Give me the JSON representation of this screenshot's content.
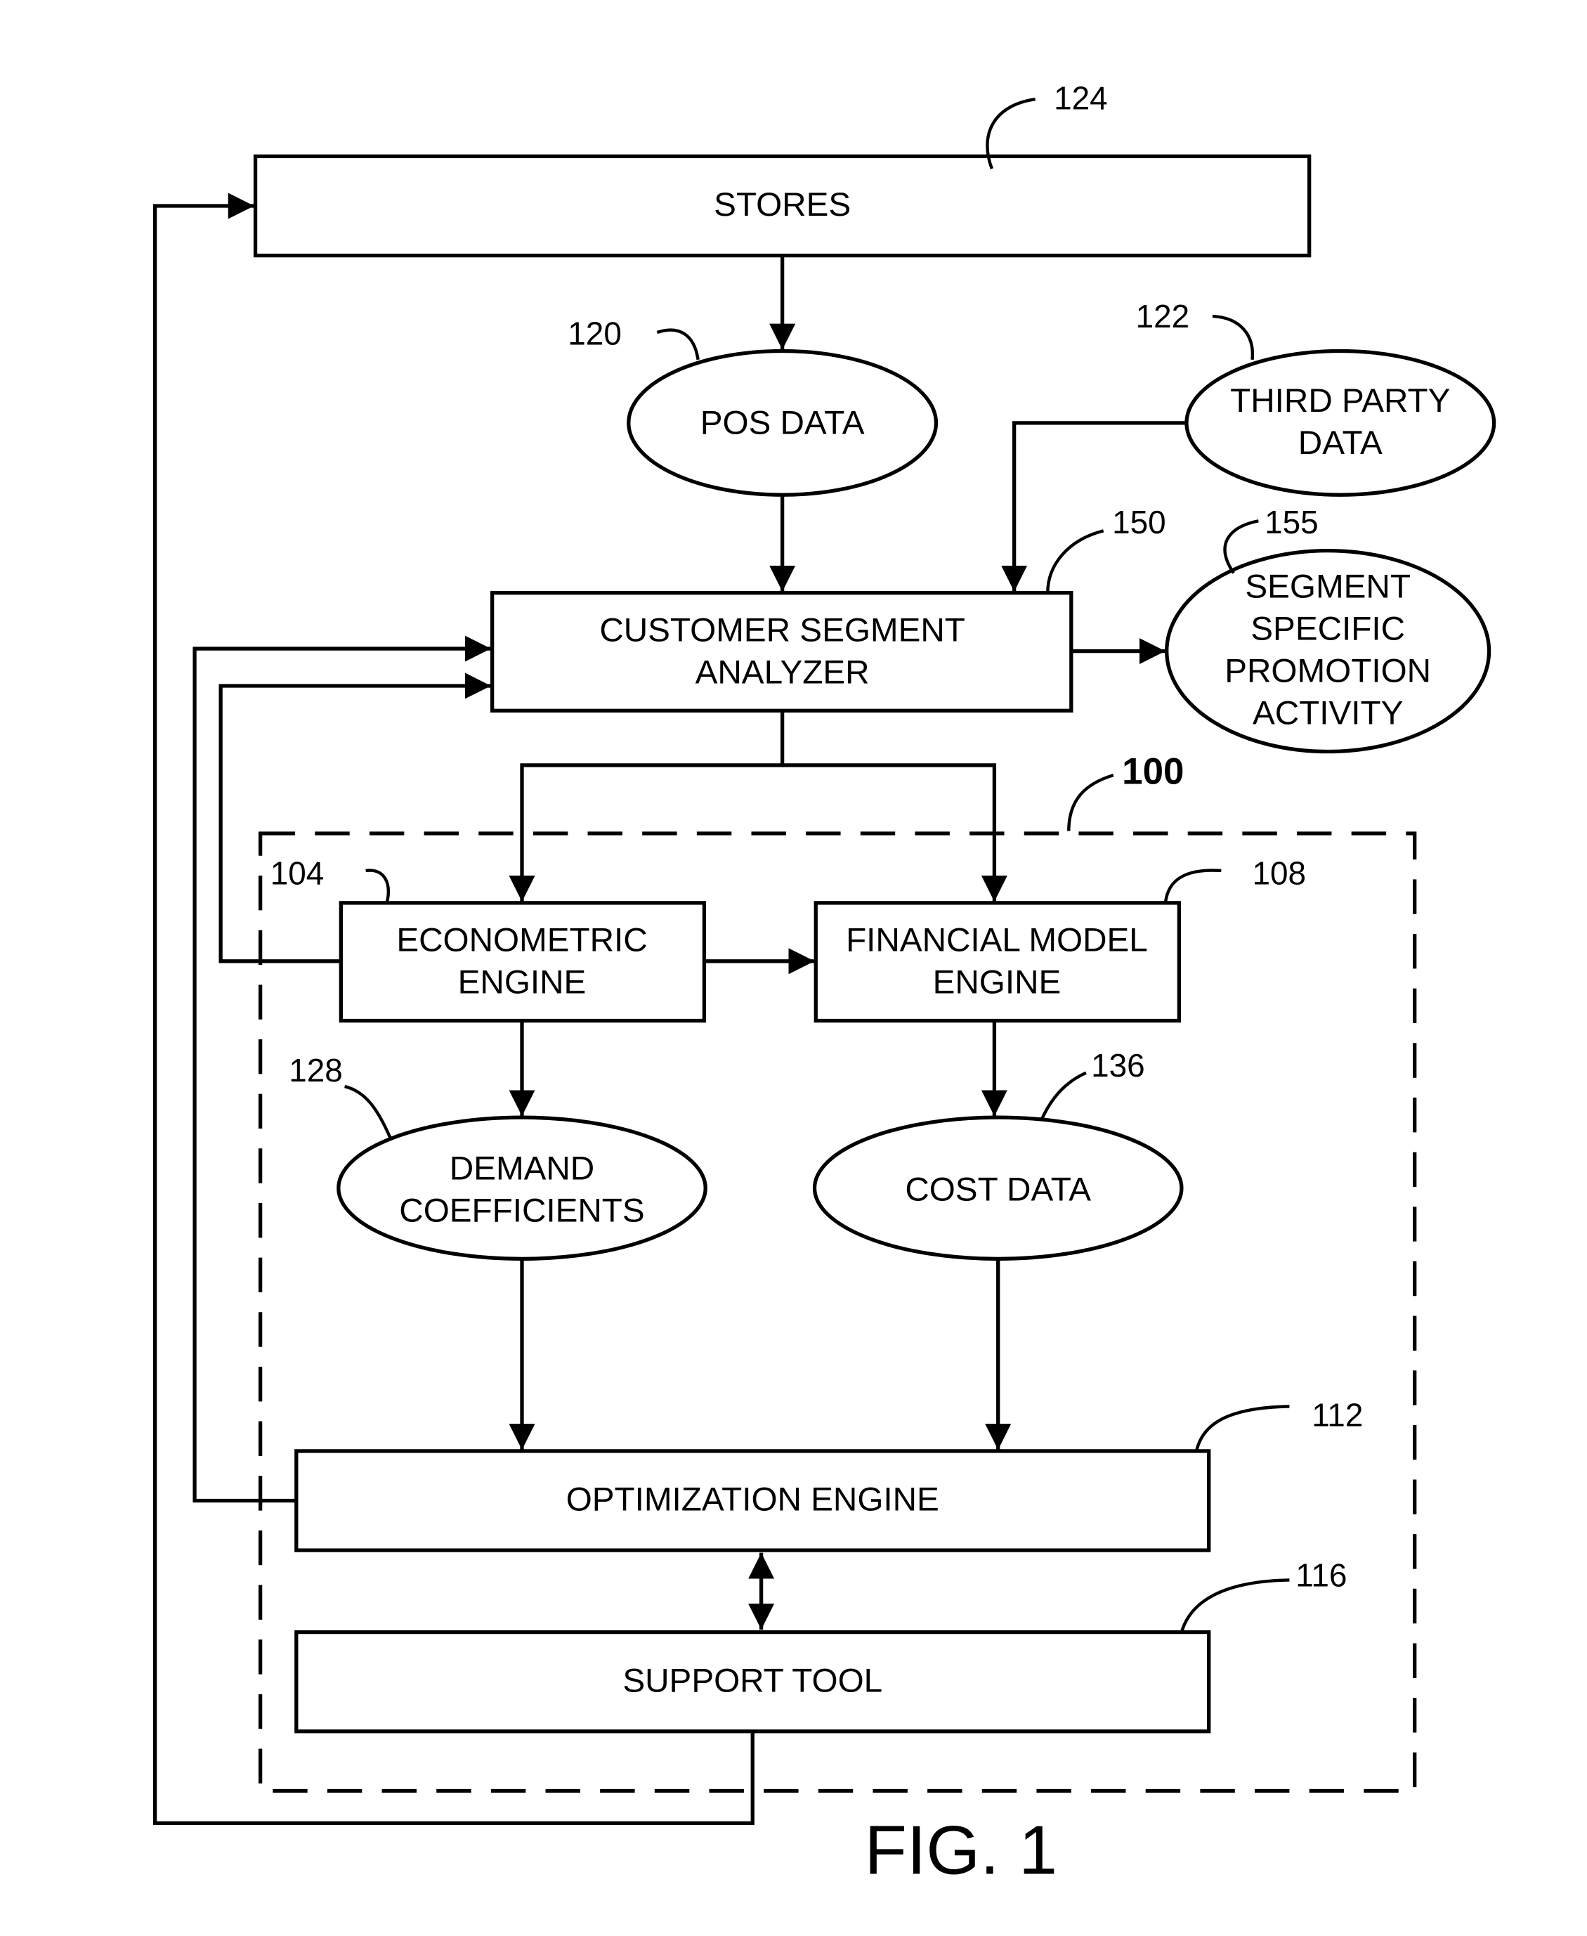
{
  "figure": {
    "caption": "FIG. 1",
    "system_ref": "100"
  },
  "nodes": {
    "stores": {
      "ref": "124",
      "lines": [
        "STORES"
      ]
    },
    "pos_data": {
      "ref": "120",
      "lines": [
        "POS DATA"
      ]
    },
    "third_party_data": {
      "ref": "122",
      "lines": [
        "THIRD PARTY",
        "DATA"
      ]
    },
    "customer_segment_analyzer": {
      "ref": "150",
      "lines": [
        "CUSTOMER SEGMENT",
        "ANALYZER"
      ]
    },
    "segment_specific_promotion_activity": {
      "ref": "155",
      "lines": [
        "SEGMENT",
        "SPECIFIC",
        "PROMOTION",
        "ACTIVITY"
      ]
    },
    "econometric_engine": {
      "ref": "104",
      "lines": [
        "ECONOMETRIC",
        "ENGINE"
      ]
    },
    "financial_model_engine": {
      "ref": "108",
      "lines": [
        "FINANCIAL MODEL",
        "ENGINE"
      ]
    },
    "demand_coefficients": {
      "ref": "128",
      "lines": [
        "DEMAND",
        "COEFFICIENTS"
      ]
    },
    "cost_data": {
      "ref": "136",
      "lines": [
        "COST DATA"
      ]
    },
    "optimization_engine": {
      "ref": "112",
      "lines": [
        "OPTIMIZATION ENGINE"
      ]
    },
    "support_tool": {
      "ref": "116",
      "lines": [
        "SUPPORT TOOL"
      ]
    }
  },
  "edges": [
    {
      "from": "stores",
      "to": "pos_data"
    },
    {
      "from": "pos_data",
      "to": "customer_segment_analyzer"
    },
    {
      "from": "third_party_data",
      "to": "customer_segment_analyzer"
    },
    {
      "from": "customer_segment_analyzer",
      "to": "segment_specific_promotion_activity"
    },
    {
      "from": "customer_segment_analyzer",
      "to": "econometric_engine"
    },
    {
      "from": "customer_segment_analyzer",
      "to": "financial_model_engine"
    },
    {
      "from": "econometric_engine",
      "to": "financial_model_engine"
    },
    {
      "from": "econometric_engine",
      "to": "customer_segment_analyzer"
    },
    {
      "from": "optimization_engine",
      "to": "customer_segment_analyzer"
    },
    {
      "from": "econometric_engine",
      "to": "demand_coefficients"
    },
    {
      "from": "financial_model_engine",
      "to": "cost_data"
    },
    {
      "from": "demand_coefficients",
      "to": "optimization_engine"
    },
    {
      "from": "cost_data",
      "to": "optimization_engine"
    },
    {
      "from": "optimization_engine",
      "to": "support_tool",
      "bidirectional": true
    },
    {
      "from": "support_tool",
      "to": "stores"
    }
  ]
}
